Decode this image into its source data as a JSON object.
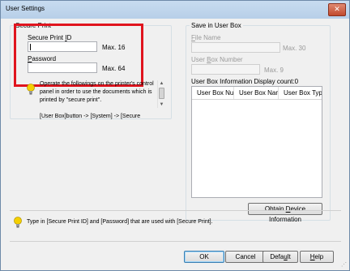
{
  "window": {
    "title": "User Settings",
    "close_glyph": "✕"
  },
  "secure_print": {
    "legend": "Secure Print",
    "id_label_pre": "Secure Print ",
    "id_label_ul": "I",
    "id_label_post": "D",
    "id_value": "",
    "id_max": "Max. 16",
    "password_label_ul": "P",
    "password_label_post": "assword",
    "password_value": "",
    "password_max": "Max. 64",
    "note_icon": "lightbulb-icon",
    "note_text": "Operate the followings on the printer's control panel in order to use the documents which is printed by \"secure print\".\n\n[User Box]button -> [System] -> [Secure"
  },
  "user_box": {
    "legend": "Save in User Box",
    "file_name_label_ul": "F",
    "file_name_label_post": "ile Name",
    "file_name_max": "Max. 30",
    "box_number_label_pre": "User ",
    "box_number_label_ul": "B",
    "box_number_label_post": "ox Number",
    "box_number_max": "Max. 9",
    "info_label": "User Box Information  Display count:0",
    "columns": [
      "User Box Nu...",
      "User Box Name",
      "User Box Type"
    ],
    "obtain_button_pre": "Obtain ",
    "obtain_button_ul": "D",
    "obtain_button_post": "evice Information"
  },
  "bottom": {
    "note_icon": "lightbulb-icon",
    "note_text": "Type in [Secure Print ID] and [Password] that are used with [Secure Print]."
  },
  "buttons": {
    "ok": "OK",
    "cancel": "Cancel",
    "default_pre": "Defa",
    "default_ul": "u",
    "default_post": "lt",
    "help_ul": "H",
    "help_post": "elp"
  },
  "colors": {
    "highlight_border": "#e0141e",
    "bulb": "#f5d000"
  }
}
